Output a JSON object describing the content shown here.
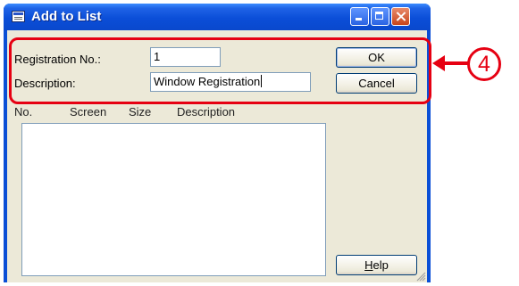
{
  "window": {
    "title": "Add to List",
    "icon": "window-list-icon"
  },
  "form": {
    "registration_label": "Registration No.:",
    "registration_value": "1",
    "description_label": "Description:",
    "description_value": "Window Registration"
  },
  "buttons": {
    "ok": "OK",
    "cancel": "Cancel",
    "help_prefix": "",
    "help_underlined": "H",
    "help_suffix": "elp"
  },
  "list": {
    "columns": [
      "No.",
      "Screen",
      "Size",
      "Description"
    ]
  },
  "annotation": {
    "callout": "4",
    "color": "#e60012"
  }
}
